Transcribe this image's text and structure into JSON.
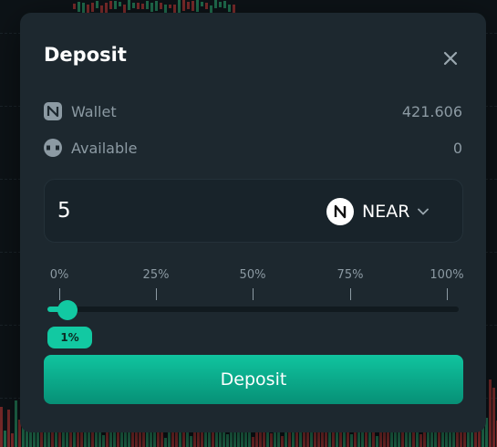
{
  "modal": {
    "title": "Deposit",
    "wallet_label": "Wallet",
    "wallet_value": "421.606",
    "available_label": "Available",
    "available_value": "0",
    "amount_value": "5",
    "token": "NEAR",
    "slider": {
      "labels": [
        "0%",
        "25%",
        "50%",
        "75%",
        "100%"
      ],
      "value_percent": 1,
      "badge": "1%"
    },
    "deposit_label": "Deposit"
  },
  "icons": {
    "close": "close-icon",
    "wallet": "near-logo-icon",
    "available": "vault-icon",
    "token": "near-logo-icon",
    "dropdown": "chevron-down-icon"
  },
  "colors": {
    "accent": "#12c9a2",
    "modal_bg": "#1d282f",
    "text_muted": "#8c9aa3"
  }
}
